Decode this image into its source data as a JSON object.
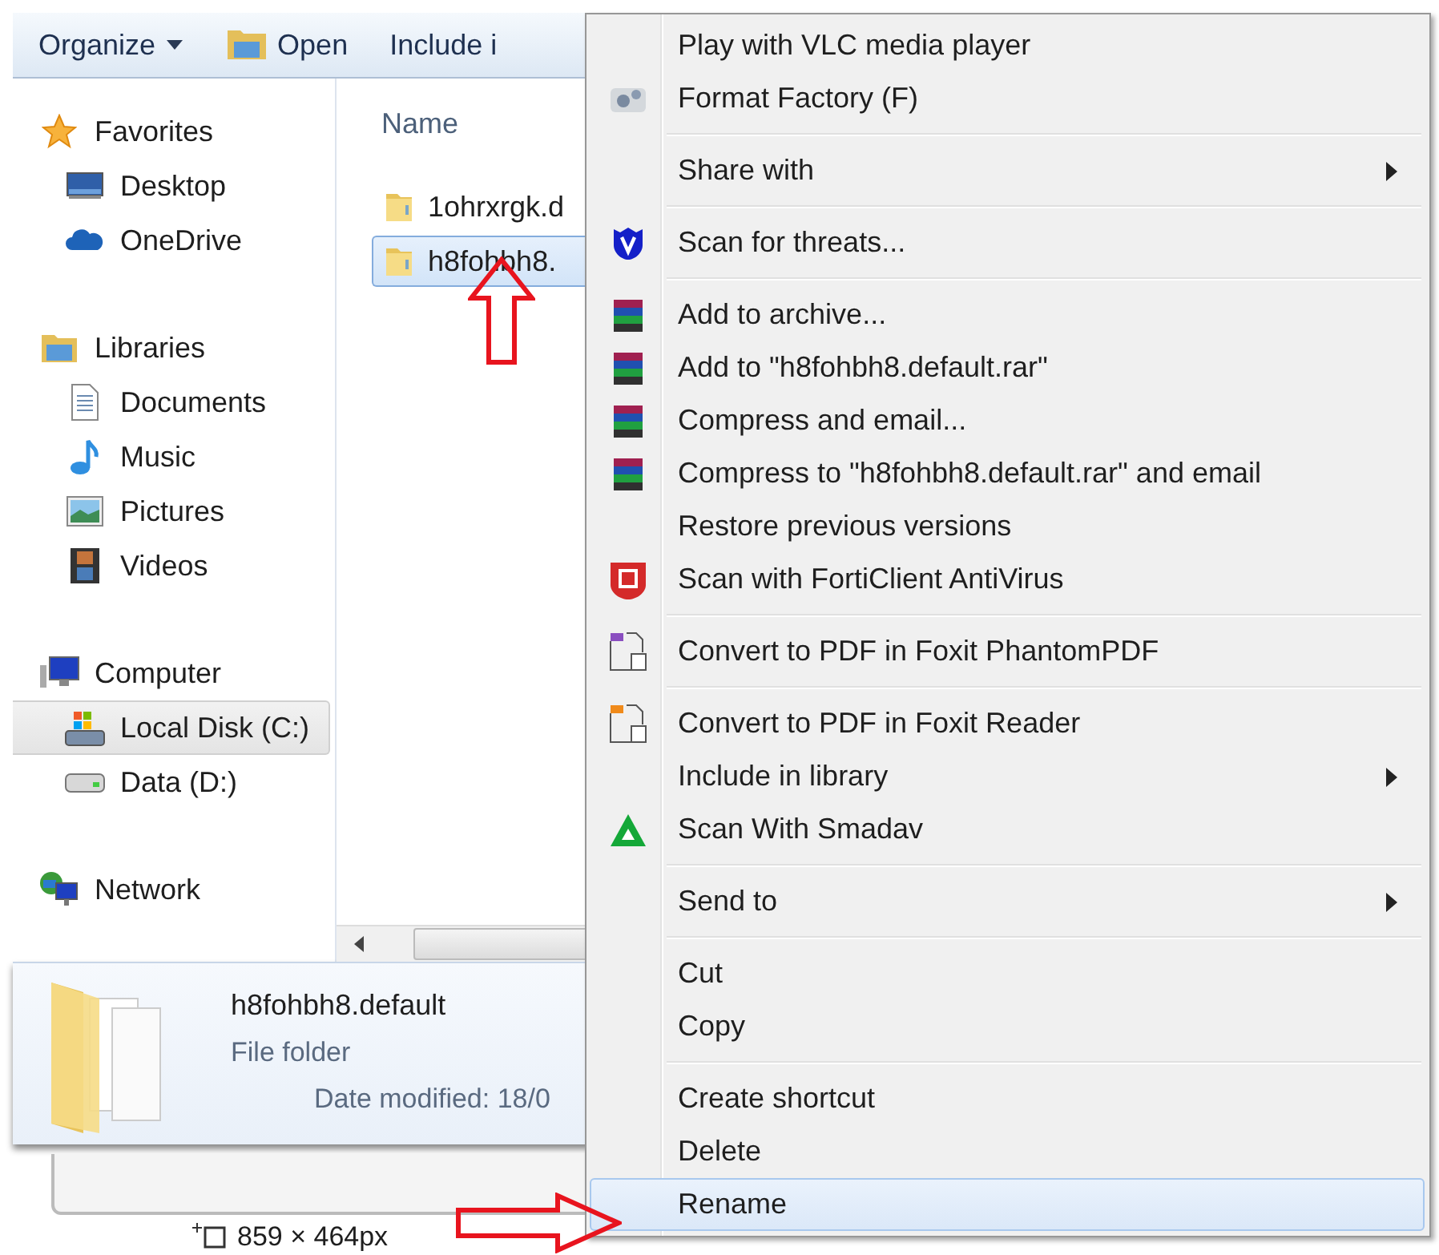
{
  "toolbar": [
    {
      "label": "Organize",
      "kind": "dropdown"
    },
    {
      "label": "Open",
      "kind": "open"
    },
    {
      "label": "Include i",
      "kind": "plain"
    }
  ],
  "nav": [
    {
      "label": "Favorites",
      "selected": false,
      "children": [
        {
          "label": "Desktop",
          "selected": false
        },
        {
          "label": "OneDrive",
          "selected": false
        }
      ]
    },
    {
      "label": "Libraries",
      "selected": false,
      "children": [
        {
          "label": "Documents",
          "selected": false
        },
        {
          "label": "Music",
          "selected": false
        },
        {
          "label": "Pictures",
          "selected": false
        },
        {
          "label": "Videos",
          "selected": false
        }
      ]
    },
    {
      "label": "Computer",
      "selected": false,
      "children": [
        {
          "label": "Local Disk (C:)",
          "selected": true
        },
        {
          "label": "Data (D:)",
          "selected": false
        }
      ]
    },
    {
      "label": "Network",
      "selected": false
    }
  ],
  "column_header": "Name",
  "files": [
    {
      "name": "1ohrxrgk.d",
      "selected": false
    },
    {
      "name": "h8fohbh8.",
      "selected": true
    }
  ],
  "details": {
    "name": "h8fohbh8.default",
    "type": "File folder",
    "date": "Date modified: 18/0"
  },
  "dimensions": "859 × 464px",
  "context_menu": [
    {
      "kind": "item",
      "label": "Play with VLC media player",
      "submenu": false,
      "selected": false
    },
    {
      "kind": "item",
      "label": "Format Factory (F)",
      "submenu": false,
      "selected": false
    },
    {
      "kind": "separator"
    },
    {
      "kind": "item",
      "label": "Share with",
      "submenu": true,
      "selected": false
    },
    {
      "kind": "separator"
    },
    {
      "kind": "item",
      "label": "Scan for threats...",
      "submenu": false,
      "selected": false
    },
    {
      "kind": "separator"
    },
    {
      "kind": "item",
      "label": "Add to archive...",
      "submenu": false,
      "selected": false
    },
    {
      "kind": "item",
      "label": "Add to \"h8fohbh8.default.rar\"",
      "submenu": false,
      "selected": false
    },
    {
      "kind": "item",
      "label": "Compress and email...",
      "submenu": false,
      "selected": false
    },
    {
      "kind": "item",
      "label": "Compress to \"h8fohbh8.default.rar\" and email",
      "submenu": false,
      "selected": false
    },
    {
      "kind": "item",
      "label": "Restore previous versions",
      "submenu": false,
      "selected": false
    },
    {
      "kind": "item",
      "label": "Scan with FortiClient AntiVirus",
      "submenu": false,
      "selected": false
    },
    {
      "kind": "separator"
    },
    {
      "kind": "item",
      "label": "Convert to PDF in Foxit PhantomPDF",
      "submenu": false,
      "selected": false
    },
    {
      "kind": "separator"
    },
    {
      "kind": "item",
      "label": "Convert to PDF in Foxit Reader",
      "submenu": false,
      "selected": false
    },
    {
      "kind": "item",
      "label": "Include in library",
      "submenu": true,
      "selected": false
    },
    {
      "kind": "item",
      "label": "Scan With Smadav",
      "submenu": false,
      "selected": false
    },
    {
      "kind": "separator"
    },
    {
      "kind": "item",
      "label": "Send to",
      "submenu": true,
      "selected": false
    },
    {
      "kind": "separator"
    },
    {
      "kind": "item",
      "label": "Cut",
      "submenu": false,
      "selected": false
    },
    {
      "kind": "item",
      "label": "Copy",
      "submenu": false,
      "selected": false
    },
    {
      "kind": "separator"
    },
    {
      "kind": "item",
      "label": "Create shortcut",
      "submenu": false,
      "selected": false
    },
    {
      "kind": "item",
      "label": "Delete",
      "submenu": false,
      "selected": false
    },
    {
      "kind": "item",
      "label": "Rename",
      "submenu": false,
      "selected": true
    }
  ]
}
